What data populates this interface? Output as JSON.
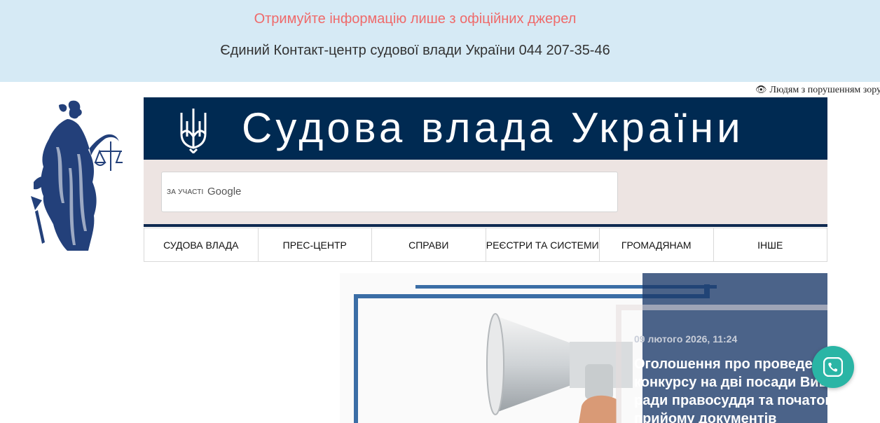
{
  "topbar": {
    "warning": "Отримуйте інформацію лише з офіційних джерел",
    "contact": "Єдиний Контакт-центр судової влади України 044 207-35-46"
  },
  "accessibility": {
    "label": "Людям з порушенням зору",
    "icon": "eye-icon"
  },
  "logo": {
    "icon": "themis-icon"
  },
  "banner": {
    "title": "Судова влада України",
    "emblem": "trident-icon"
  },
  "search": {
    "caption": "ЗА УЧАСТІ",
    "provider": "Google"
  },
  "nav": {
    "items": [
      {
        "label": "СУДОВА ВЛАДА"
      },
      {
        "label": "ПРЕС-ЦЕНТР"
      },
      {
        "label": "СПРАВИ"
      },
      {
        "label": "РЕЄСТРИ ТА СИСТЕМИ"
      },
      {
        "label": "ГРОМАДЯНАМ"
      },
      {
        "label": "ІНШЕ"
      }
    ]
  },
  "news": {
    "date": "09 лютого 2026, 11:24",
    "headline": "Оголошення про проведення конкурсу на дві посади Вищої ради правосуддя та початок прийому документів"
  },
  "chat": {
    "icon": "phone-icon"
  },
  "colors": {
    "topbar_bg": "#d6eaf5",
    "warning": "#ef6a6a",
    "banner_bg": "#002a52",
    "accent_blue": "#3b6ea6",
    "chat_bg": "#2ab5a5"
  }
}
